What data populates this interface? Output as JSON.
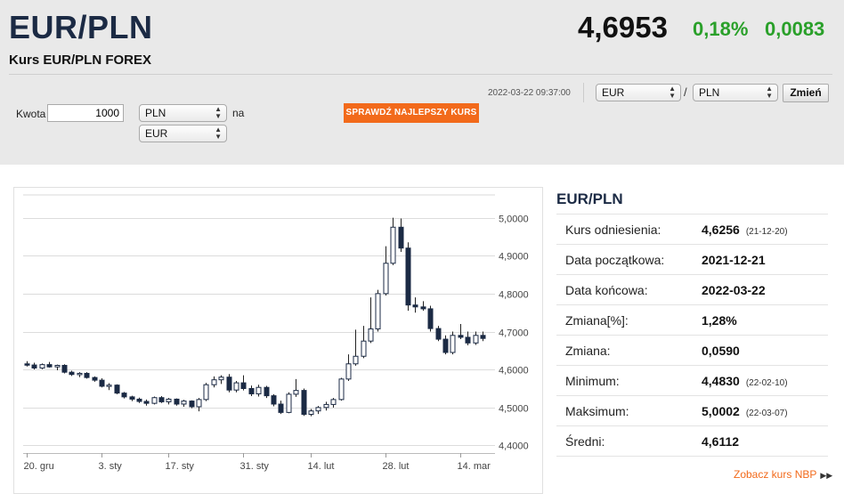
{
  "header": {
    "pair": "EUR/PLN",
    "subtitle": "Kurs EUR/PLN FOREX",
    "price": "4,6953",
    "change_pct": "0,18%",
    "change_abs": "0,0083",
    "datetime": "2022-03-22 09:37:00"
  },
  "converter": {
    "amount_label": "Kwota",
    "amount_value": "1000",
    "from_currency": "PLN",
    "to_label": "na",
    "to_currency": "EUR",
    "best_rate_button": "SPRAWDŹ NAJLEPSZY KURS"
  },
  "pair_selector": {
    "base": "EUR",
    "separator": "/",
    "quote": "PLN",
    "change_button": "Zmień"
  },
  "stats": {
    "title": "EUR/PLN",
    "rows": [
      {
        "label": "Kurs odniesienia:",
        "value": "4,6256",
        "date": "(21-12-20)"
      },
      {
        "label": "Data początkowa:",
        "value": "2021-12-21",
        "date": ""
      },
      {
        "label": "Data końcowa:",
        "value": "2022-03-22",
        "date": ""
      },
      {
        "label": "Zmiana[%]:",
        "value": "1,28%",
        "date": ""
      },
      {
        "label": "Zmiana:",
        "value": "0,0590",
        "date": ""
      },
      {
        "label": "Minimum:",
        "value": "4,4830",
        "date": "(22-02-10)"
      },
      {
        "label": "Maksimum:",
        "value": "5,0002",
        "date": "(22-03-07)"
      },
      {
        "label": "Średni:",
        "value": "4,6112",
        "date": ""
      }
    ],
    "nbp_link": "Zobacz kurs NBP",
    "nbp_icon": "double-triangle-right-icon"
  },
  "colors": {
    "accent_orange": "#f26a1b",
    "positive_green": "#2aa02a",
    "title_navy": "#1b2a44"
  },
  "chart_data": {
    "type": "candlestick",
    "ylim": [
      4.38,
      5.06
    ],
    "yticks": [
      "4,4000",
      "4,5000",
      "4,6000",
      "4,7000",
      "4,8000",
      "4,9000",
      "5,0000"
    ],
    "ytick_values": [
      4.4,
      4.5,
      4.6,
      4.7,
      4.8,
      4.9,
      5.0
    ],
    "xticks": [
      "20. gru",
      "3. sty",
      "17. sty",
      "31. sty",
      "14. lut",
      "28. lut",
      "14. mar"
    ],
    "candles": [
      [
        4.615,
        4.622,
        4.608,
        4.612
      ],
      [
        4.612,
        4.618,
        4.6,
        4.604
      ],
      [
        4.604,
        4.616,
        4.601,
        4.613
      ],
      [
        4.613,
        4.62,
        4.605,
        4.607
      ],
      [
        4.607,
        4.613,
        4.598,
        4.611
      ],
      [
        4.611,
        4.614,
        4.59,
        4.593
      ],
      [
        4.593,
        4.597,
        4.583,
        4.587
      ],
      [
        4.587,
        4.593,
        4.58,
        4.59
      ],
      [
        4.59,
        4.593,
        4.576,
        4.579
      ],
      [
        4.579,
        4.582,
        4.568,
        4.572
      ],
      [
        4.572,
        4.577,
        4.553,
        4.556
      ],
      [
        4.556,
        4.564,
        4.546,
        4.559
      ],
      [
        4.559,
        4.561,
        4.535,
        4.538
      ],
      [
        4.538,
        4.541,
        4.524,
        4.528
      ],
      [
        4.528,
        4.531,
        4.517,
        4.522
      ],
      [
        4.522,
        4.526,
        4.512,
        4.516
      ],
      [
        4.516,
        4.521,
        4.505,
        4.511
      ],
      [
        4.511,
        4.529,
        4.508,
        4.526
      ],
      [
        4.526,
        4.53,
        4.512,
        4.515
      ],
      [
        4.515,
        4.525,
        4.508,
        4.522
      ],
      [
        4.522,
        4.524,
        4.505,
        4.509
      ],
      [
        4.509,
        4.52,
        4.502,
        4.517
      ],
      [
        4.517,
        4.519,
        4.498,
        4.502
      ],
      [
        4.502,
        4.525,
        4.49,
        4.521
      ],
      [
        4.521,
        4.565,
        4.517,
        4.56
      ],
      [
        4.56,
        4.582,
        4.553,
        4.573
      ],
      [
        4.573,
        4.585,
        4.562,
        4.58
      ],
      [
        4.58,
        4.588,
        4.54,
        4.546
      ],
      [
        4.546,
        4.57,
        4.54,
        4.565
      ],
      [
        4.565,
        4.585,
        4.545,
        4.55
      ],
      [
        4.55,
        4.558,
        4.53,
        4.536
      ],
      [
        4.536,
        4.56,
        4.529,
        4.553
      ],
      [
        4.553,
        4.557,
        4.525,
        4.531
      ],
      [
        4.531,
        4.535,
        4.503,
        4.509
      ],
      [
        4.509,
        4.518,
        4.483,
        4.487
      ],
      [
        4.487,
        4.54,
        4.485,
        4.535
      ],
      [
        4.535,
        4.575,
        4.528,
        4.545
      ],
      [
        4.545,
        4.55,
        4.478,
        4.482
      ],
      [
        4.482,
        4.496,
        4.477,
        4.491
      ],
      [
        4.491,
        4.504,
        4.483,
        4.5
      ],
      [
        4.5,
        4.515,
        4.492,
        4.508
      ],
      [
        4.508,
        4.525,
        4.5,
        4.521
      ],
      [
        4.521,
        4.578,
        4.518,
        4.575
      ],
      [
        4.575,
        4.64,
        4.57,
        4.615
      ],
      [
        4.615,
        4.705,
        4.61,
        4.635
      ],
      [
        4.635,
        4.715,
        4.63,
        4.675
      ],
      [
        4.675,
        4.79,
        4.67,
        4.707
      ],
      [
        4.707,
        4.81,
        4.7,
        4.8
      ],
      [
        4.8,
        4.925,
        4.795,
        4.88
      ],
      [
        4.88,
        5.0,
        4.875,
        4.975
      ],
      [
        4.975,
        4.998,
        4.91,
        4.92
      ],
      [
        4.92,
        4.935,
        4.755,
        4.77
      ],
      [
        4.77,
        4.79,
        4.75,
        4.765
      ],
      [
        4.765,
        4.78,
        4.755,
        4.76
      ],
      [
        4.76,
        4.768,
        4.7,
        4.708
      ],
      [
        4.708,
        4.715,
        4.675,
        4.68
      ],
      [
        4.68,
        4.69,
        4.64,
        4.645
      ],
      [
        4.645,
        4.7,
        4.64,
        4.69
      ],
      [
        4.69,
        4.72,
        4.68,
        4.685
      ],
      [
        4.685,
        4.7,
        4.664,
        4.67
      ],
      [
        4.67,
        4.7,
        4.665,
        4.69
      ],
      [
        4.69,
        4.7,
        4.675,
        4.682
      ]
    ]
  }
}
